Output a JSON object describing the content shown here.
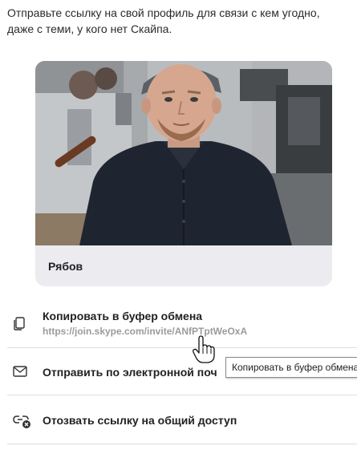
{
  "intro": {
    "line1": "Отправьте ссылку на свой профиль для связи с кем угодно,",
    "line2": "даже с теми, у кого нет Скайпа."
  },
  "card": {
    "name": "Рябов"
  },
  "actions": {
    "copy": {
      "label": "Копировать в буфер обмена",
      "link": "https://join.skype.com/invite/ANfPTptWeOxA",
      "icon": "copy-icon"
    },
    "email": {
      "label": "Отправить по электронной поч",
      "icon": "envelope-icon"
    },
    "revoke": {
      "label": "Отозвать ссылку на общий доступ",
      "icon": "unlink-icon"
    }
  },
  "tooltip": {
    "text": "Копировать в буфер обмена"
  },
  "colors": {
    "card_background": "#ececf0",
    "divider": "#dedede",
    "muted_text": "#9b9b9b"
  }
}
